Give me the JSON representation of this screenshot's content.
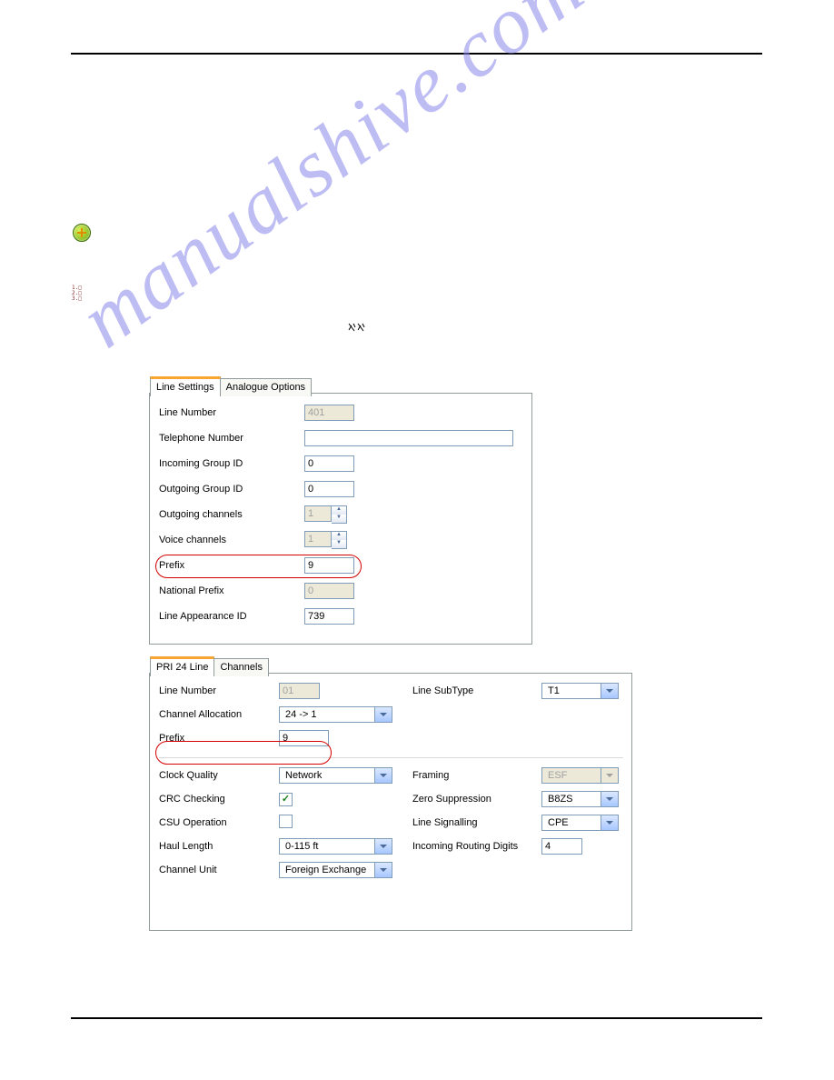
{
  "watermark": "manualshive.com",
  "panel1": {
    "tabs": {
      "active": "Line Settings",
      "inactive": "Analogue Options"
    },
    "fields": {
      "line_number_label": "Line Number",
      "line_number_value": "401",
      "telephone_number_label": "Telephone Number",
      "telephone_number_value": "",
      "incoming_group_label": "Incoming Group ID",
      "incoming_group_value": "0",
      "outgoing_group_label": "Outgoing Group ID",
      "outgoing_group_value": "0",
      "outgoing_channels_label": "Outgoing channels",
      "outgoing_channels_value": "1",
      "voice_channels_label": "Voice channels",
      "voice_channels_value": "1",
      "prefix_label": "Prefix",
      "prefix_value": "9",
      "national_prefix_label": "National Prefix",
      "national_prefix_value": "0",
      "line_appearance_label": "Line Appearance ID",
      "line_appearance_value": "739"
    }
  },
  "panel2": {
    "tabs": {
      "active": "PRI 24 Line",
      "inactive": "Channels"
    },
    "fields": {
      "line_number_label": "Line Number",
      "line_number_value": "01",
      "line_subtype_label": "Line SubType",
      "line_subtype_value": "T1",
      "channel_allocation_label": "Channel Allocation",
      "channel_allocation_value": "24 -> 1",
      "prefix_label": "Prefix",
      "prefix_value": "9",
      "clock_quality_label": "Clock Quality",
      "clock_quality_value": "Network",
      "framing_label": "Framing",
      "framing_value": "ESF",
      "crc_checking_label": "CRC Checking",
      "crc_checking_value": true,
      "zero_suppression_label": "Zero Suppression",
      "zero_suppression_value": "B8ZS",
      "csu_operation_label": "CSU Operation",
      "csu_operation_value": false,
      "line_signalling_label": "Line Signalling",
      "line_signalling_value": "CPE",
      "haul_length_label": "Haul Length",
      "haul_length_value": "0-115 ft",
      "incoming_routing_label": "Incoming Routing Digits",
      "incoming_routing_value": "4",
      "channel_unit_label": "Channel Unit",
      "channel_unit_value": "Foreign Exchange"
    }
  }
}
